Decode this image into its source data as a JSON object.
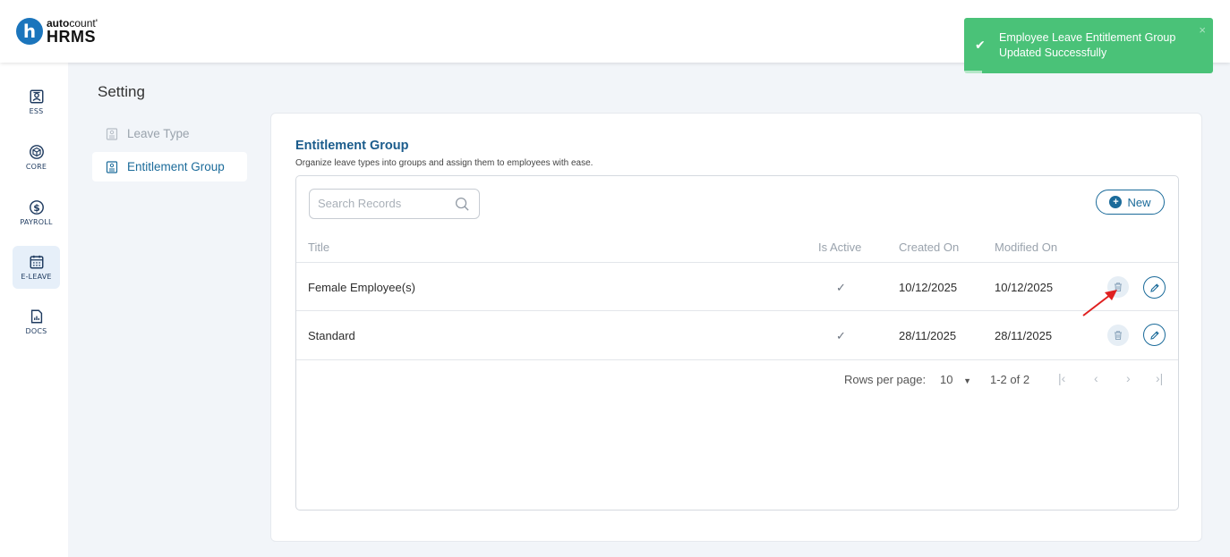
{
  "brand": {
    "top_bold": "auto",
    "top_light": "count",
    "mark": "'",
    "bottom": "HRMS",
    "logo_letter": "h"
  },
  "toast": {
    "message": "Employee Leave Entitlement Group Updated Successfully",
    "close": "×",
    "color": "#4ac278"
  },
  "rail": [
    {
      "label": "ESS",
      "icon": "id-card-icon"
    },
    {
      "label": "CORE",
      "icon": "cube-icon"
    },
    {
      "label": "PAYROLL",
      "icon": "dollar-icon"
    },
    {
      "label": "E-LEAVE",
      "icon": "calendar-icon",
      "active": true
    },
    {
      "label": "DOCS",
      "icon": "document-chart-icon"
    }
  ],
  "setting": {
    "title": "Setting",
    "subnav": [
      {
        "label": "Leave Type",
        "active": false
      },
      {
        "label": "Entitlement Group",
        "active": true
      }
    ]
  },
  "main": {
    "title": "Entitlement Group",
    "subtitle": "Organize leave types into groups and assign them to employees with ease.",
    "search_placeholder": "Search Records",
    "new_label": "New",
    "columns": {
      "title": "Title",
      "is_active": "Is Active",
      "created_on": "Created On",
      "modified_on": "Modified On"
    },
    "rows": [
      {
        "title": "Female Employee(s)",
        "is_active": "✓",
        "created_on": "10/12/2025",
        "modified_on": "10/12/2025"
      },
      {
        "title": "Standard",
        "is_active": "✓",
        "created_on": "28/11/2025",
        "modified_on": "28/11/2025"
      }
    ],
    "pager": {
      "rows_per_page_label": "Rows per page:",
      "rows_per_page": "10",
      "range": "1-2 of 2"
    }
  },
  "colors": {
    "accent": "#1b6b9a",
    "brand": "#1b75bc",
    "arrow": "#e02020"
  }
}
